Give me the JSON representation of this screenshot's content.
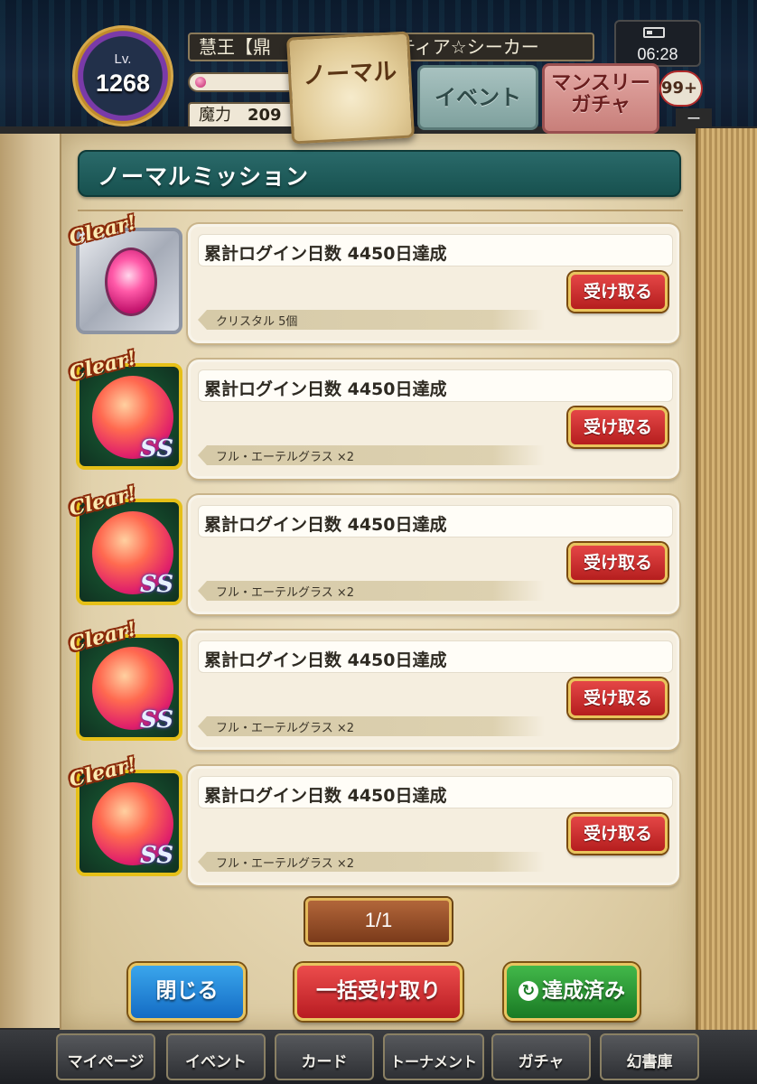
{
  "player": {
    "level_label": "Lv.",
    "level": "1268",
    "name": "慧王【鼎",
    "name_trailing": "ティア☆シーカー",
    "mana_label": "魔力",
    "mana_value": "209",
    "clock": "06:28",
    "count_badge": "99+",
    "count_tag": "ー"
  },
  "tabs": [
    {
      "label": "ノーマル",
      "active": true
    },
    {
      "label": "イベント",
      "active": false
    },
    {
      "label": "マンスリー\nガチャ",
      "active": false
    }
  ],
  "section_title": "ノーマルミッション",
  "missions": [
    {
      "clear": "Clear!",
      "title": "累計ログイン日数 4450日達成",
      "claim": "受け取る",
      "reward": "クリスタル 5個",
      "icon": "crystal-icon"
    },
    {
      "clear": "Clear!",
      "title": "累計ログイン日数 4450日達成",
      "claim": "受け取る",
      "reward": "フル・エーテルグラス ×2",
      "icon": "aether-glass-icon",
      "rank": "SS"
    },
    {
      "clear": "Clear!",
      "title": "累計ログイン日数 4450日達成",
      "claim": "受け取る",
      "reward": "フル・エーテルグラス ×2",
      "icon": "aether-glass-icon",
      "rank": "SS"
    },
    {
      "clear": "Clear!",
      "title": "累計ログイン日数 4450日達成",
      "claim": "受け取る",
      "reward": "フル・エーテルグラス ×2",
      "icon": "aether-glass-icon",
      "rank": "SS"
    },
    {
      "clear": "Clear!",
      "title": "累計ログイン日数 4450日達成",
      "claim": "受け取る",
      "reward": "フル・エーテルグラス ×2",
      "icon": "aether-glass-icon",
      "rank": "SS"
    }
  ],
  "pager": "1/1",
  "actions": {
    "close": "閉じる",
    "claim_all": "一括受け取り",
    "done": "達成済み"
  },
  "nav": [
    {
      "label": "マイページ"
    },
    {
      "label": "イベント"
    },
    {
      "label": "カード"
    },
    {
      "label": "トーナメント"
    },
    {
      "label": "ガチャ"
    },
    {
      "label": "幻書庫"
    }
  ],
  "colors": {
    "header_teal": "#17514f",
    "claim_red": "#b51e1e",
    "close_blue": "#146cc4",
    "done_green": "#1a7a24",
    "page_parchment": "#e5d6b2"
  }
}
